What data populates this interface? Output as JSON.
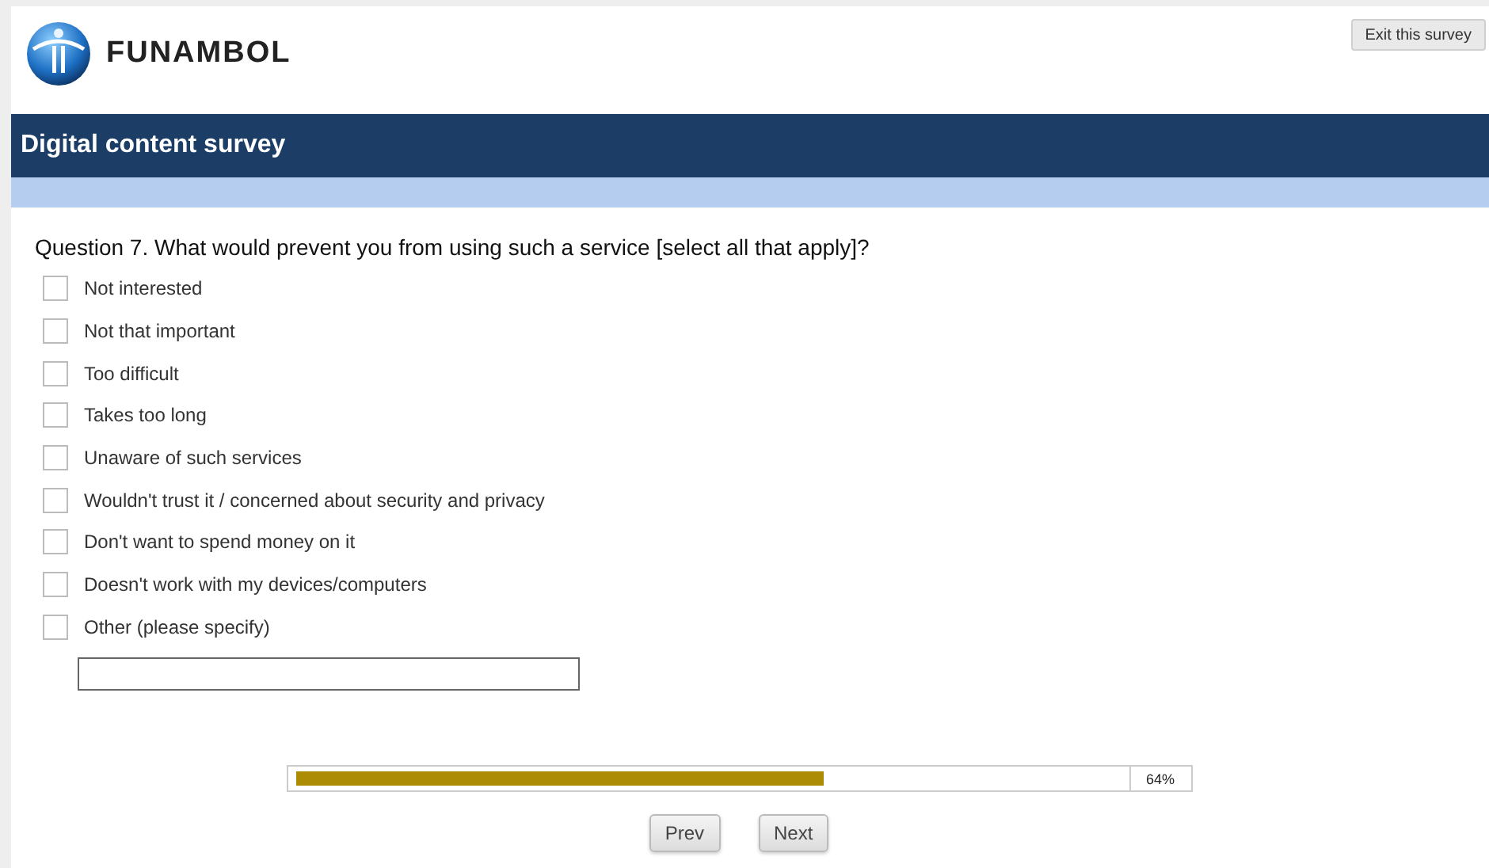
{
  "header": {
    "brand": "FUNAMBOL",
    "exit_button": "Exit this survey"
  },
  "survey": {
    "title": "Digital content survey"
  },
  "question": {
    "text": "Question 7. What would prevent you from using such a service [select all that apply]?",
    "options": [
      {
        "label": "Not interested",
        "checked": false
      },
      {
        "label": "Not that important",
        "checked": false
      },
      {
        "label": "Too difficult",
        "checked": false
      },
      {
        "label": "Takes too long",
        "checked": false
      },
      {
        "label": "Unaware of such services",
        "checked": false
      },
      {
        "label": "Wouldn't trust it / concerned about security and privacy",
        "checked": false
      },
      {
        "label": "Don't want to spend money on it",
        "checked": false
      },
      {
        "label": "Doesn't work with my devices/computers",
        "checked": false
      },
      {
        "label": "Other (please specify)",
        "checked": false
      }
    ]
  },
  "progress": {
    "level": 0.64,
    "reading": "64%"
  },
  "buttons": [
    "Prev",
    "Next"
  ]
}
